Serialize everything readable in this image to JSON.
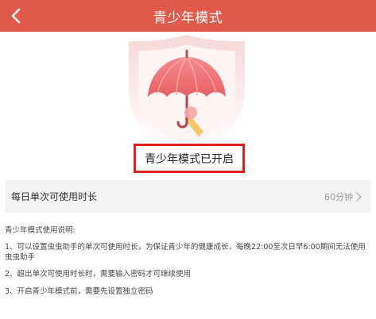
{
  "header": {
    "title": "青少年模式"
  },
  "status": {
    "text": "青少年模式已开启"
  },
  "setting": {
    "label": "每日单次可使用时长",
    "value": "60分钟"
  },
  "instructions": {
    "heading": "青少年模式使用说明:",
    "items": [
      "1、可以设置虫虫助手的单次可使用时长，为保证青少年的健康成长，每晚22:00至次日早6:00期间无法使用虫虫助手",
      "2、超出单次可使用时长时，需要输入密码才可继续使用",
      "3、开启青少年模式前，需要先设置独立密码"
    ]
  },
  "colors": {
    "header_bg": "#e05a4a",
    "highlight_border": "#e0201c",
    "umbrella": "#ee6f6f",
    "shield": "#fbeaea"
  },
  "icons": {
    "back": "chevron-left-icon",
    "illustration": "umbrella-shield-illustration",
    "arrow": "chevron-right-icon"
  }
}
